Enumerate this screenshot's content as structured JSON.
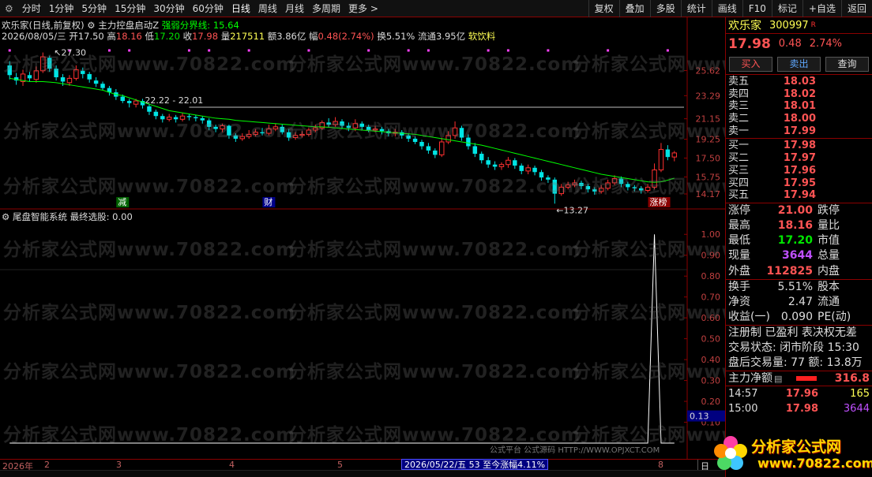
{
  "toolbar": {
    "periods": [
      "分时",
      "1分钟",
      "5分钟",
      "15分钟",
      "30分钟",
      "60分钟",
      "日线",
      "周线",
      "月线",
      "多周期",
      "更多"
    ],
    "selected": "日线",
    "right_buttons": [
      "复权",
      "叠加",
      "多股",
      "统计",
      "画线",
      "F10",
      "标记",
      "+自选",
      "返回"
    ]
  },
  "main": {
    "title_line": "欢乐家(日线,前复权)",
    "indicator_name": "主力控盘启动Z",
    "indicator_label": "强弱分界线: 15.64",
    "bar_date": "2026/08/05/三",
    "open_label": "开",
    "open": "17.50",
    "high_label": "高",
    "high": "18.16",
    "low_label": "低",
    "low": "17.20",
    "close_label": "收",
    "close": "17.98",
    "vol_label": "量",
    "vol": "217511",
    "amt_label": "额",
    "amt": "3.86亿",
    "amp_label": "幅",
    "amp": "0.48(2.74%)",
    "turn_label": "换",
    "turn": "5.51%",
    "float_label": "流通",
    "float": "3.95亿",
    "sector": "软饮料",
    "sub_indicator": "尾盘智能系统  最终选股: 0.00",
    "annot_high": "27.30",
    "annot_low": "13.27",
    "annot_range": "22.22 - 22.01",
    "marker_jian": "减",
    "marker_cai": "财",
    "marker_zhangting": "涨榜",
    "price_ticks": [
      "25.62",
      "23.29",
      "21.15",
      "19.25",
      "17.50",
      "15.75",
      "14.17"
    ],
    "sub_ticks": [
      "1.00",
      "0.90",
      "0.80",
      "0.70",
      "0.60",
      "0.50",
      "0.40",
      "0.30",
      "0.20",
      "0.10"
    ],
    "sub_current": "0.13",
    "time_labels": [
      "2026年",
      "2",
      "3",
      "4",
      "5",
      "8"
    ],
    "date_badge": "2026/05/22/五 53 至今涨幅4.11%",
    "corner_label": "日",
    "bottom_note": "公式平台  公式源码  HTTP://WWW.OPJXCT.COM",
    "watermark": "分析家公式网www.70822.com"
  },
  "chart_data": {
    "type": "candlestick",
    "candles": [
      [
        26.1,
        25.2,
        26.5,
        24.8
      ],
      [
        25.0,
        24.7,
        25.4,
        24.3
      ],
      [
        24.6,
        25.3,
        25.7,
        24.2
      ],
      [
        25.2,
        24.9,
        25.5,
        24.6
      ],
      [
        24.8,
        25.6,
        26.0,
        24.5
      ],
      [
        25.6,
        26.9,
        27.3,
        25.4
      ],
      [
        26.8,
        25.8,
        27.0,
        25.5
      ],
      [
        25.8,
        25.0,
        26.1,
        24.7
      ],
      [
        25.0,
        24.6,
        25.3,
        24.2
      ],
      [
        24.5,
        24.9,
        25.2,
        24.2
      ],
      [
        24.9,
        25.7,
        26.1,
        24.7
      ],
      [
        25.6,
        25.3,
        25.9,
        24.9
      ],
      [
        25.3,
        24.8,
        25.5,
        24.5
      ],
      [
        24.7,
        24.4,
        25.0,
        24.1
      ],
      [
        24.4,
        24.0,
        24.6,
        23.8
      ],
      [
        24.0,
        23.6,
        24.2,
        23.3
      ],
      [
        23.6,
        23.2,
        23.9,
        22.9
      ],
      [
        23.2,
        22.8,
        23.4,
        22.6
      ],
      [
        22.8,
        22.6,
        23.0,
        22.2
      ],
      [
        22.5,
        22.8,
        23.0,
        22.2
      ],
      [
        22.8,
        22.4,
        23.0,
        22.1
      ],
      [
        22.3,
        21.8,
        22.5,
        21.5
      ],
      [
        21.8,
        21.4,
        22.0,
        21.1
      ],
      [
        21.4,
        21.1,
        21.6,
        20.8
      ],
      [
        21.1,
        21.3,
        21.6,
        20.9
      ],
      [
        21.3,
        21.1,
        21.5,
        20.8
      ],
      [
        21.1,
        21.4,
        21.7,
        20.9
      ],
      [
        21.4,
        21.3,
        21.6,
        21.0
      ],
      [
        21.3,
        21.2,
        21.5,
        20.9
      ],
      [
        21.2,
        21.0,
        21.4,
        20.7
      ],
      [
        21.0,
        20.4,
        21.2,
        20.1
      ],
      [
        20.4,
        20.2,
        20.6,
        19.9
      ],
      [
        20.2,
        20.5,
        20.7,
        19.9
      ],
      [
        20.5,
        19.6,
        20.6,
        19.3
      ],
      [
        19.6,
        19.3,
        19.8,
        19.0
      ],
      [
        19.3,
        19.5,
        19.8,
        19.1
      ],
      [
        19.5,
        19.7,
        20.1,
        19.3
      ],
      [
        19.7,
        19.9,
        20.2,
        19.5
      ],
      [
        19.9,
        19.8,
        20.3,
        19.6
      ],
      [
        19.8,
        20.2,
        20.6,
        19.6
      ],
      [
        20.2,
        20.4,
        20.7,
        20.0
      ],
      [
        20.4,
        19.9,
        20.6,
        19.7
      ],
      [
        19.9,
        19.4,
        20.2,
        19.1
      ],
      [
        19.4,
        19.6,
        19.9,
        19.2
      ],
      [
        19.6,
        19.7,
        20.0,
        19.4
      ],
      [
        19.7,
        20.1,
        20.3,
        19.5
      ],
      [
        20.1,
        20.3,
        20.6,
        19.9
      ],
      [
        20.3,
        20.8,
        21.0,
        20.1
      ],
      [
        20.8,
        20.6,
        21.2,
        20.4
      ],
      [
        20.6,
        20.9,
        21.3,
        20.4
      ],
      [
        20.9,
        20.5,
        21.1,
        20.2
      ],
      [
        20.5,
        20.3,
        20.8,
        20.0
      ],
      [
        20.3,
        20.7,
        21.1,
        20.0
      ],
      [
        20.7,
        20.4,
        20.9,
        20.1
      ],
      [
        20.4,
        20.1,
        20.6,
        19.9
      ],
      [
        20.1,
        20.2,
        20.5,
        19.9
      ],
      [
        20.2,
        20.0,
        20.4,
        19.7
      ],
      [
        20.0,
        19.8,
        20.2,
        19.5
      ],
      [
        19.8,
        19.9,
        20.2,
        19.5
      ],
      [
        19.9,
        19.6,
        20.1,
        19.3
      ],
      [
        19.6,
        19.3,
        19.8,
        19.0
      ],
      [
        19.3,
        19.0,
        19.5,
        18.8
      ],
      [
        19.0,
        18.6,
        19.2,
        18.3
      ],
      [
        18.6,
        18.2,
        18.9,
        17.9
      ],
      [
        18.2,
        17.8,
        18.4,
        17.5
      ],
      [
        17.8,
        19.0,
        19.4,
        17.6
      ],
      [
        19.0,
        19.6,
        20.0,
        18.8
      ],
      [
        19.6,
        20.3,
        20.9,
        19.3
      ],
      [
        20.3,
        19.4,
        20.5,
        19.1
      ],
      [
        19.4,
        18.6,
        19.7,
        18.3
      ],
      [
        18.6,
        17.9,
        18.9,
        17.6
      ],
      [
        17.9,
        17.3,
        18.1,
        17.0
      ],
      [
        17.3,
        16.9,
        17.6,
        16.6
      ],
      [
        16.9,
        16.7,
        17.2,
        16.4
      ],
      [
        16.7,
        16.9,
        17.1,
        16.4
      ],
      [
        16.9,
        17.3,
        17.6,
        16.6
      ],
      [
        17.3,
        16.8,
        17.5,
        16.5
      ],
      [
        16.8,
        16.3,
        17.0,
        16.0
      ],
      [
        16.3,
        16.6,
        16.9,
        16.0
      ],
      [
        16.6,
        16.2,
        16.8,
        15.9
      ],
      [
        16.2,
        15.7,
        16.4,
        15.4
      ],
      [
        15.7,
        15.5,
        15.9,
        15.2
      ],
      [
        15.5,
        14.2,
        15.7,
        13.27
      ],
      [
        14.2,
        14.8,
        15.1,
        14.0
      ],
      [
        14.8,
        15.0,
        15.3,
        14.6
      ],
      [
        15.0,
        15.2,
        15.5,
        14.8
      ],
      [
        15.2,
        14.9,
        15.4,
        14.6
      ],
      [
        14.9,
        14.6,
        15.1,
        14.3
      ],
      [
        14.6,
        14.4,
        14.8,
        14.1
      ],
      [
        14.4,
        14.7,
        15.0,
        14.2
      ],
      [
        14.7,
        15.2,
        15.5,
        14.5
      ],
      [
        15.2,
        15.6,
        15.9,
        15.0
      ],
      [
        15.6,
        15.1,
        15.8,
        14.8
      ],
      [
        15.1,
        14.8,
        15.3,
        14.5
      ],
      [
        14.8,
        14.7,
        15.0,
        14.4
      ],
      [
        14.7,
        14.5,
        14.9,
        14.2
      ],
      [
        14.5,
        14.8,
        15.1,
        14.3
      ],
      [
        14.8,
        16.4,
        17.0,
        14.6
      ],
      [
        16.4,
        18.3,
        18.9,
        16.2
      ],
      [
        18.3,
        17.6,
        18.7,
        17.3
      ],
      [
        17.6,
        17.98,
        18.16,
        17.2
      ]
    ],
    "ma": [
      24.9,
      24.8,
      24.7,
      24.6,
      24.6,
      24.6,
      24.55,
      24.5,
      24.4,
      24.3,
      24.2,
      24.1,
      24.0,
      23.9,
      23.8,
      23.6,
      23.4,
      23.3,
      23.1,
      22.9,
      22.7,
      22.5,
      22.3,
      22.1,
      21.9,
      21.8,
      21.7,
      21.6,
      21.5,
      21.4,
      21.3,
      21.2,
      21.15,
      21.1,
      21.0,
      20.95,
      20.9,
      20.85,
      20.8,
      20.75,
      20.7,
      20.65,
      20.6,
      20.55,
      20.5,
      20.45,
      20.4,
      20.4,
      20.35,
      20.3,
      20.25,
      20.2,
      20.15,
      20.1,
      20.05,
      20.0,
      19.95,
      19.9,
      19.85,
      19.8,
      19.75,
      19.7,
      19.6,
      19.5,
      19.4,
      19.3,
      19.2,
      19.1,
      19.0,
      18.9,
      18.8,
      18.7,
      18.55,
      18.4,
      18.25,
      18.1,
      17.95,
      17.8,
      17.65,
      17.5,
      17.35,
      17.2,
      17.05,
      16.9,
      16.75,
      16.6,
      16.45,
      16.3,
      16.15,
      16.0,
      15.9,
      15.8,
      15.7,
      15.6,
      15.5,
      15.4,
      15.3,
      15.25,
      15.3,
      15.45,
      15.64
    ],
    "signal": [
      0,
      0,
      0,
      0,
      0,
      0,
      0,
      0,
      0,
      0,
      0,
      0,
      0,
      0,
      0,
      0,
      0,
      0,
      0,
      0,
      0,
      0,
      0,
      0,
      0,
      0,
      0,
      0,
      0,
      0,
      0,
      0,
      0,
      0,
      0,
      0,
      0,
      0,
      0,
      0,
      0,
      0,
      0,
      0,
      0,
      0,
      0,
      0,
      0,
      0,
      0,
      0,
      0,
      0,
      0,
      0,
      0,
      0,
      0,
      0,
      0,
      0,
      0,
      0,
      0,
      0,
      0,
      0,
      0,
      0,
      0,
      0,
      0,
      0,
      0,
      0,
      0,
      0,
      0,
      0,
      0,
      0,
      0,
      0,
      0,
      0,
      0,
      0,
      0,
      0,
      0,
      0,
      0,
      0,
      0,
      0,
      0,
      1.0,
      0,
      0,
      0
    ],
    "price_ylim": [
      13.0,
      28.0
    ],
    "sub_ylim": [
      0.0,
      1.05
    ]
  },
  "right": {
    "name": "欢乐家",
    "code": "300997",
    "flag": "R",
    "price": "17.98",
    "change": "0.48",
    "pct": "2.74%",
    "buttons": [
      "买入",
      "卖出",
      "查询"
    ],
    "asks": [
      [
        "卖五",
        "18.03"
      ],
      [
        "卖四",
        "18.02"
      ],
      [
        "卖三",
        "18.01"
      ],
      [
        "卖二",
        "18.00"
      ],
      [
        "卖一",
        "17.99"
      ]
    ],
    "bids": [
      [
        "买一",
        "17.98"
      ],
      [
        "买二",
        "17.97"
      ],
      [
        "买三",
        "17.96"
      ],
      [
        "买四",
        "17.95"
      ],
      [
        "买五",
        "17.94"
      ]
    ],
    "stats": [
      [
        "涨停",
        "21.00",
        "跌停",
        "#ff5454"
      ],
      [
        "最高",
        "18.16",
        "量比",
        "#ff5454"
      ],
      [
        "最低",
        "17.20",
        "市值",
        "#00e600"
      ],
      [
        "现量",
        "3644",
        "总量",
        "#c050ff"
      ],
      [
        "外盘",
        "112825",
        "内盘",
        "#ff5454"
      ]
    ],
    "stats2": [
      [
        "换手",
        "5.51%",
        "股本"
      ],
      [
        "净资",
        "2.47",
        "流通"
      ],
      [
        "收益(一)",
        "0.090",
        "PE(动)"
      ]
    ],
    "reg_line": "注册制 已盈利 表决权无差",
    "trade_state": "交易状态: 闭市阶段 15:30",
    "after_hours": "盘后交易量: 77  额: 13.8万",
    "flow_label": "主力净额",
    "flow_val": "316.8",
    "ticks": [
      [
        "14:57",
        "17.96",
        "165",
        "#ffff54"
      ],
      [
        "15:00",
        "17.98",
        "3644",
        "#c050ff"
      ]
    ],
    "logo_top": "分析家公式网",
    "logo_bottom": "www.70822.com"
  }
}
